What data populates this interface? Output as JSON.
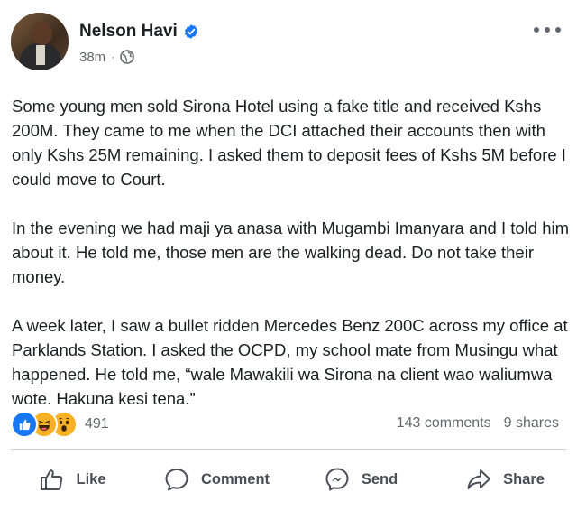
{
  "post": {
    "author": "Nelson Havi",
    "time": "38m",
    "separator": "·",
    "paragraphs": [
      "Some young men sold Sirona Hotel using a fake title and received Kshs 200M. They came to me when the DCI attached their accounts then with only Kshs 25M remaining. I asked them to deposit fees of Kshs 5M before I could move to Court.",
      "In the evening we had maji ya anasa with Mugambi Imanyara and I told him about it. He told me, those men are the walking dead. Do not take their money.",
      "A week later, I saw a bullet ridden Mercedes Benz 200C across my office at Parklands Station. I asked the OCPD, my school mate from Musingu what happened. He told me, “wale Mawakili wa Sirona na client wao waliumwa wote. Hakuna kesi tena.”"
    ]
  },
  "engagement": {
    "reaction_count": "491",
    "comments": "143 comments",
    "shares": "9 shares",
    "reaction_icons": [
      "like-icon",
      "haha-icon",
      "wow-icon"
    ]
  },
  "actions": {
    "like": "Like",
    "comment": "Comment",
    "send": "Send",
    "share": "Share"
  },
  "colors": {
    "verified": "#1877f2",
    "like_blue": "#1877f2",
    "emoji_yellow": "#f7b125",
    "secondary_text": "#65676b"
  }
}
